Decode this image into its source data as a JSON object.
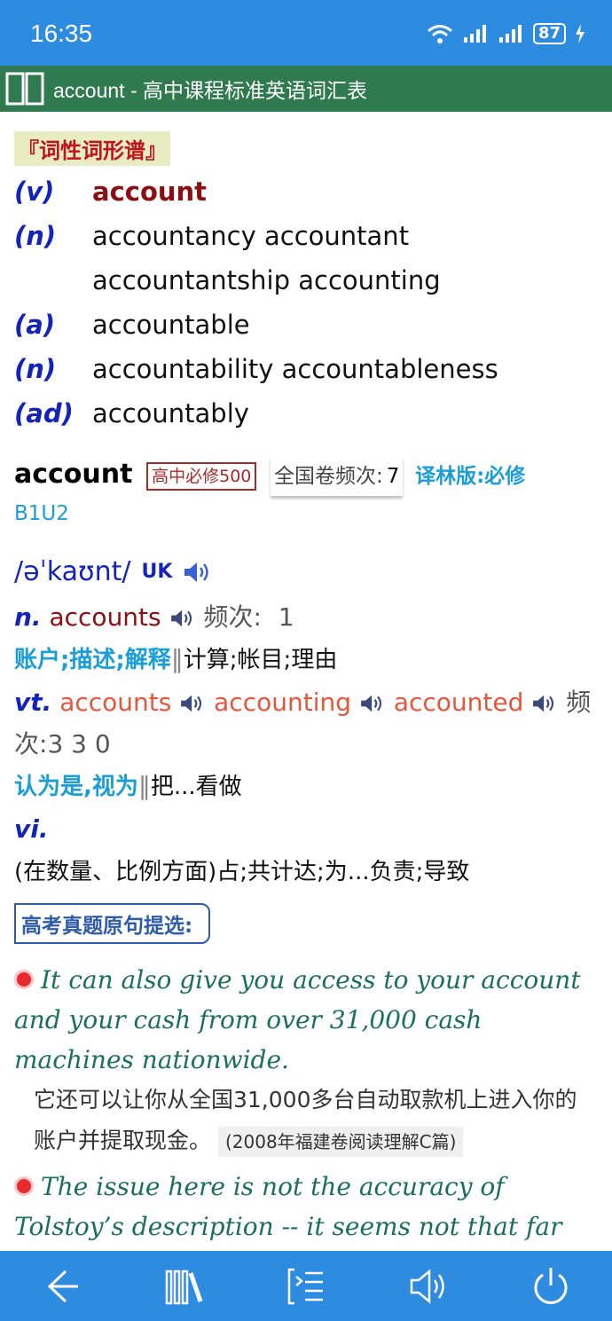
{
  "status": {
    "time": "16:35",
    "battery": "87"
  },
  "title": "account - 高中课程标准英语词汇表",
  "word_family": {
    "tag": "『词性词形谱』",
    "rows": [
      {
        "pos": "(v)",
        "forms": "account"
      },
      {
        "pos": "(n)",
        "forms": "accountancy accountant accountantship accounting"
      },
      {
        "pos": "(a)",
        "forms": "accountable"
      },
      {
        "pos": "(n)",
        "forms": "accountability accountableness"
      },
      {
        "pos": "(ad)",
        "forms": "accountably"
      }
    ]
  },
  "entry": {
    "headword": "account",
    "badge": "高中必修500",
    "freq_label": "全国卷频次:",
    "freq_value": "7",
    "yilin": "译林版:必修",
    "unit": "B1U2",
    "phonetic": "/əˈkaʊnt/",
    "uk": "UK",
    "noun": {
      "pos": "n.",
      "form": "accounts",
      "freq_label": "频次:",
      "freq_value": "1",
      "def_key": "账户;描述;解释",
      "def_rest": "计算;帐目;理由"
    },
    "vt": {
      "pos": "vt.",
      "forms": [
        "accounts",
        "accounting",
        "accounted"
      ],
      "freq_label": "频",
      "freq_label2": "次:",
      "freq_value": "3 3 0",
      "def_key": "认为是,视为",
      "def_rest": "把...看做"
    },
    "vi": {
      "pos": "vi.",
      "def": "(在数量、比例方面)占;共计达;为...负责;导致"
    }
  },
  "exam": {
    "label": "高考真题原句提选:",
    "examples": [
      {
        "en": "It can also give you access to your account and your cash from over 31,000 cash machines nationwide.",
        "zh": "它还可以让你从全国31,000多台自动取款机上进入你的账户并提取现金。",
        "source": "(2008年福建卷阅读理解C篇)"
      },
      {
        "en": "The issue here is not the accuracy of Tolstoy’s description -- it seems not that far off from"
      }
    ]
  },
  "nav": [
    "back-icon",
    "library-icon",
    "toc-icon",
    "speaker-icon",
    "power-icon"
  ]
}
